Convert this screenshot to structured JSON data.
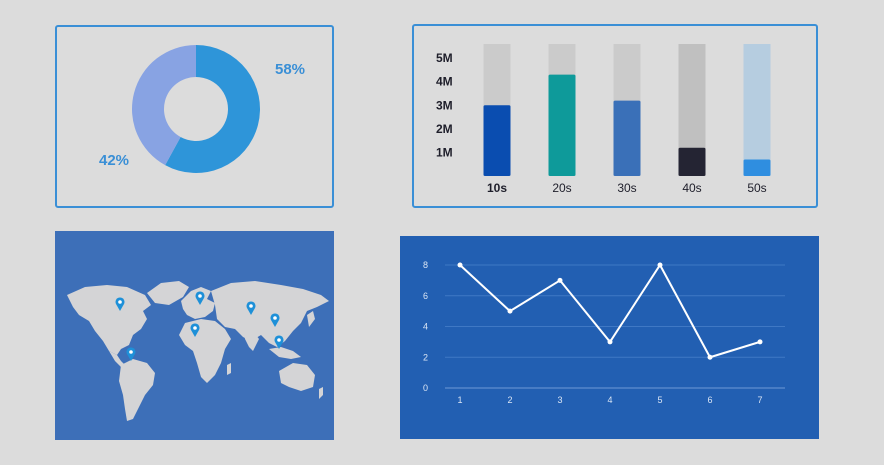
{
  "chart_data": [
    {
      "type": "pie",
      "variant": "donut",
      "slices": [
        {
          "label": "58%",
          "value": 58,
          "color": "#2e95d9"
        },
        {
          "label": "42%",
          "value": 42,
          "color": "#88a3e3"
        }
      ]
    },
    {
      "type": "bar",
      "categories": [
        "10s",
        "20s",
        "30s",
        "40s",
        "50s"
      ],
      "values": [
        3.0,
        4.3,
        3.2,
        1.2,
        0.7
      ],
      "ymax": 5.6,
      "yticks": [
        "1M",
        "2M",
        "3M",
        "4M",
        "5M"
      ],
      "ytick_values": [
        1,
        2,
        3,
        4,
        5
      ],
      "bar_colors": [
        "#0a4db0",
        "#0e9a9a",
        "#3a70b8",
        "#242433",
        "#2f8ee0"
      ],
      "track_colors": [
        "#cbcbcb",
        "#cbcbcb",
        "#cbcbcb",
        "#c0c0c0",
        "#b6cde0"
      ],
      "bold_category": "10s"
    },
    {
      "type": "map",
      "description_markers": 7,
      "land_color": "#d4d4d6",
      "marker_color": "#1e90d8"
    },
    {
      "type": "line",
      "x": [
        1,
        2,
        3,
        4,
        5,
        6,
        7
      ],
      "y": [
        8,
        5,
        7,
        3,
        8,
        2,
        3
      ],
      "ylim": [
        0,
        8
      ],
      "yticks": [
        0,
        2,
        4,
        6,
        8
      ],
      "grid": true,
      "line_color": "#ffffff"
    }
  ]
}
